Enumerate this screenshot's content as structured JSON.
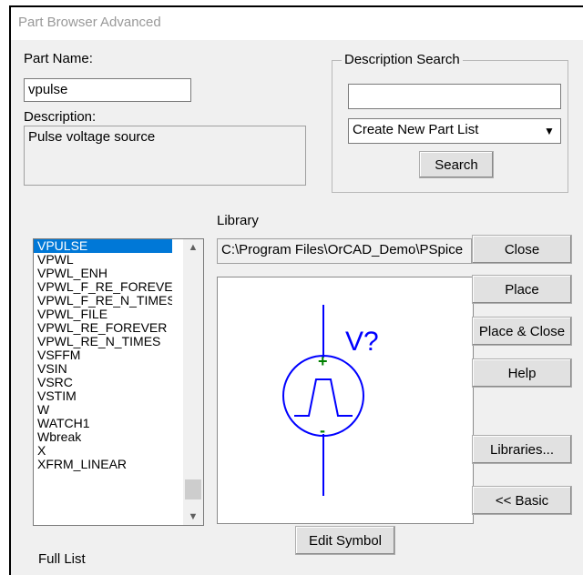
{
  "window": {
    "title": "Part Browser Advanced"
  },
  "part_name": {
    "label": "Part Name:",
    "value": "vpulse"
  },
  "description": {
    "label": "Description:",
    "value": "Pulse voltage source"
  },
  "description_search": {
    "title": "Description Search",
    "input_value": "",
    "combo_value": "Create New Part List",
    "search_label": "Search"
  },
  "parts_list": {
    "items": [
      "VPULSE",
      "VPWL",
      "VPWL_ENH",
      "VPWL_F_RE_FOREVER",
      "VPWL_F_RE_N_TIMES",
      "VPWL_FILE",
      "VPWL_RE_FOREVER",
      "VPWL_RE_N_TIMES",
      "VSFFM",
      "VSIN",
      "VSRC",
      "VSTIM",
      "W",
      "WATCH1",
      "Wbreak",
      "X",
      "XFRM_LINEAR"
    ],
    "selected_index": 0
  },
  "library": {
    "label": "Library",
    "value": "C:\\Program Files\\OrCAD_Demo\\PSpice"
  },
  "symbol": {
    "refdes": "V?",
    "plus": "+",
    "minus": "-"
  },
  "buttons": {
    "close": "Close",
    "place": "Place",
    "place_close": "Place & Close",
    "help": "Help",
    "libraries": "Libraries...",
    "basic": "<< Basic",
    "edit_symbol": "Edit Symbol"
  },
  "footer": {
    "full_list": "Full List"
  },
  "colors": {
    "selection": "#0078d7",
    "symbol_line": "#0000ff",
    "symbol_pin": "#008000"
  }
}
